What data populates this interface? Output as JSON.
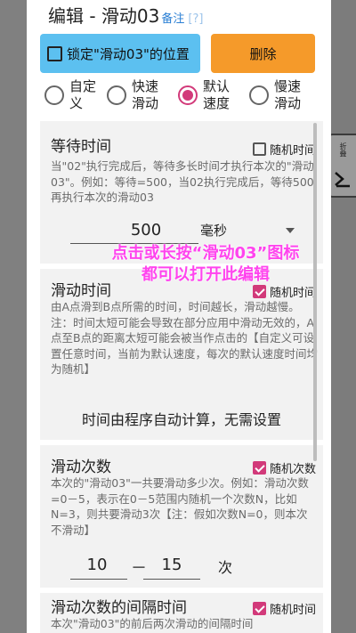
{
  "dialog": {
    "title": "编辑 - 滑动03",
    "note_link": "备注",
    "help_link": "[?]"
  },
  "buttons": {
    "lock_label": "锁定\"滑动03\"的位置",
    "delete_label": "删除"
  },
  "speed": {
    "options": [
      {
        "label": "自定义",
        "selected": false
      },
      {
        "label": "快速滑动",
        "selected": false
      },
      {
        "label": "默认速度",
        "selected": true
      },
      {
        "label": "慢速滑动",
        "selected": false
      }
    ]
  },
  "wait": {
    "title": "等待时间",
    "random_label": "随机时间",
    "random_checked": false,
    "desc": "当\"02\"执行完成后，等待多长时间才执行本次的\"滑动03\"。例如：等待=500，当02执行完成后，等待500再执行本次的滑动03",
    "value": "500",
    "unit": "毫秒"
  },
  "tip": {
    "line1": "点击或长按“滑动03”图标",
    "line2": "都可以打开此编辑"
  },
  "swipe_time": {
    "title": "滑动时间",
    "random_label": "随机时间",
    "random_checked": true,
    "desc": "由A点滑到B点所需的时间，时间越长，滑动越慢。注：时间太短可能会导致在部分应用中滑动无效的，A点至B点的距离太短可能会被当作点击的【自定义可设置任意时间，当前为默认速度，每次的默认速度时间均为随机】",
    "auto_text": "时间由程序自动计算，无需设置"
  },
  "swipe_count": {
    "title": "滑动次数",
    "random_label": "随机次数",
    "random_checked": true,
    "desc": "本次的\"滑动03\"一共要滑动多少次。例如：滑动次数=0－5，表示在0－5范围内随机一个次数N，比如N=3，则共要滑动3次【注：假如次数N=0，则本次不滑动】",
    "min": "10",
    "dash": "－",
    "max": "15",
    "unit": "次"
  },
  "interval": {
    "title": "滑动次数的间隔时间",
    "random_label": "随机时间",
    "random_checked": true,
    "desc": "本次\"滑动03\"的前后两次滑动的间隔时间"
  },
  "side_widget": {
    "label": "折叠"
  },
  "colors": {
    "accent": "#d23a7a",
    "lock_button": "#5cc0f0",
    "delete_button": "#f59a2a",
    "tip_text": "#ff44ee",
    "link": "#2a7fd4"
  }
}
